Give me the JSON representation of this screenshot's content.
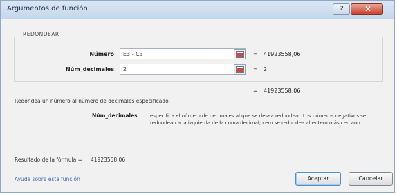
{
  "window": {
    "title": "Argumentos de función",
    "help": "?",
    "close": "✕"
  },
  "function": {
    "name": "REDONDEAR",
    "args": [
      {
        "label": "Número",
        "value": "E3 - C3",
        "eq": "=",
        "result": "41923558,06"
      },
      {
        "label": "Núm_decimales",
        "value": "2",
        "eq": "=",
        "result": "2"
      }
    ],
    "total_eq": "=",
    "total": "41923558,06",
    "description": "Redondea un número al número de decimales especificado.",
    "arg_help_name": "Núm_decimales",
    "arg_help_text": "especifica el número de decimales al que se desea redondear. Los números negativos se redondean a la izquierda de la coma decimal; cero se redondea al entero más cercano."
  },
  "footer": {
    "formula_result_label": "Resultado de la fórmula =",
    "formula_result_value": "41923558,06",
    "help_link": "Ayuda sobre esta función",
    "ok": "Aceptar",
    "cancel": "Cancelar"
  }
}
